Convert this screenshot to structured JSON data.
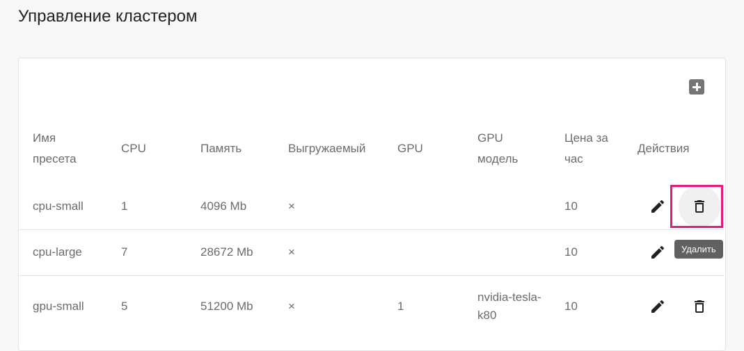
{
  "page": {
    "title": "Управление кластером"
  },
  "toolbar": {
    "add_icon": "add-box-icon"
  },
  "table": {
    "columns": [
      "Имя пресета",
      "CPU",
      "Память",
      "Выгружаемый",
      "GPU",
      "GPU модель",
      "Цена за час",
      "Действия"
    ],
    "rows": [
      {
        "name": "cpu-small",
        "cpu": "1",
        "memory": "4096 Mb",
        "preemptible": "×",
        "gpu": "",
        "gpu_model": "",
        "price": "10"
      },
      {
        "name": "cpu-large",
        "cpu": "7",
        "memory": "28672 Mb",
        "preemptible": "×",
        "gpu": "",
        "gpu_model": "",
        "price": "10"
      },
      {
        "name": "gpu-small",
        "cpu": "5",
        "memory": "51200 Mb",
        "preemptible": "×",
        "gpu": "1",
        "gpu_model": "nvidia-tesla-k80",
        "price": "10"
      }
    ]
  },
  "actions": {
    "edit_icon": "pencil-icon",
    "delete_icon": "trash-icon",
    "delete_tooltip": "Удалить"
  },
  "colors": {
    "background": "#f7f7f9",
    "icon": "#212121",
    "add_icon": "#757575",
    "highlight": "#e6197f",
    "tooltip": "#616161"
  }
}
